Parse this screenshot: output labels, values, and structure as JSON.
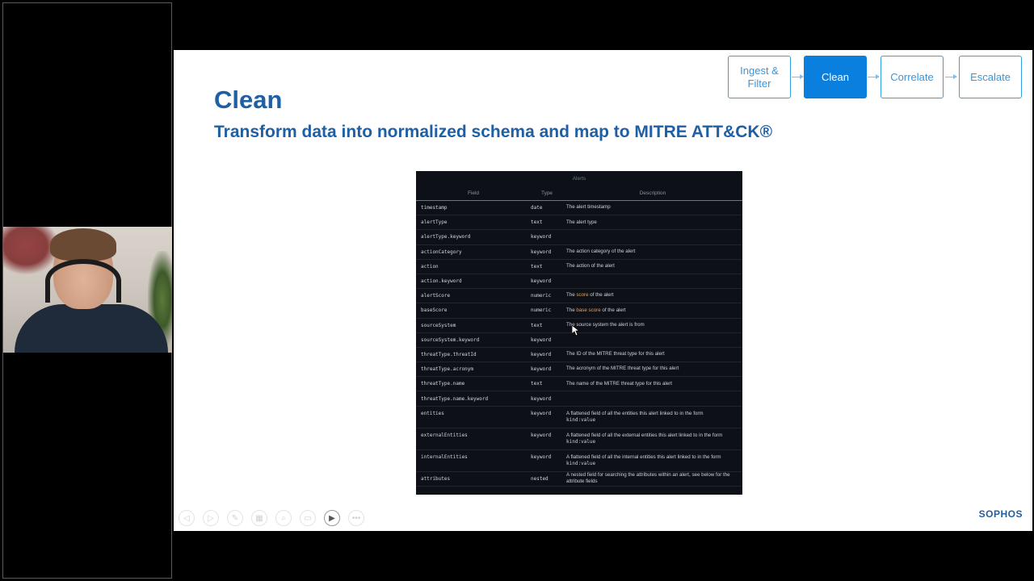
{
  "webcam": {
    "label": "presenter webcam"
  },
  "slide": {
    "title": "Clean",
    "subtitle": "Transform data into normalized schema and map to MITRE ATT&CK®",
    "flow": [
      {
        "label_line1": "Ingest &",
        "label_line2": "Filter",
        "active": false
      },
      {
        "label_line1": "Clean",
        "label_line2": "",
        "active": true
      },
      {
        "label_line1": "Correlate",
        "label_line2": "",
        "active": false
      },
      {
        "label_line1": "Escalate",
        "label_line2": "",
        "active": false
      }
    ],
    "brand": "SOPHOS"
  },
  "table": {
    "caption": "Alerts",
    "headers": {
      "field": "Field",
      "type": "Type",
      "description": "Description"
    },
    "rows": [
      {
        "field": "timestamp",
        "type": "date",
        "pre": "The alert timestamp",
        "hl": "",
        "post": "",
        "code": ""
      },
      {
        "field": "alertType",
        "type": "text",
        "pre": "The alert type",
        "hl": "",
        "post": "",
        "code": ""
      },
      {
        "field": "alertType.keyword",
        "type": "keyword",
        "pre": "",
        "hl": "",
        "post": "",
        "code": ""
      },
      {
        "field": "actionCategory",
        "type": "keyword",
        "pre": "The action category of the alert",
        "hl": "",
        "post": "",
        "code": ""
      },
      {
        "field": "action",
        "type": "text",
        "pre": "The action of the alert",
        "hl": "",
        "post": "",
        "code": ""
      },
      {
        "field": "action.keyword",
        "type": "keyword",
        "pre": "",
        "hl": "",
        "post": "",
        "code": ""
      },
      {
        "field": "alertScore",
        "type": "numeric",
        "pre": "The ",
        "hl": "score",
        "post": " of the alert",
        "code": ""
      },
      {
        "field": "baseScore",
        "type": "numeric",
        "pre": "The ",
        "hl": "base score",
        "post": " of the alert",
        "code": ""
      },
      {
        "field": "sourceSystem",
        "type": "text",
        "pre": "The source system the alert is from",
        "hl": "",
        "post": "",
        "code": ""
      },
      {
        "field": "sourceSystem.keyword",
        "type": "keyword",
        "pre": "",
        "hl": "",
        "post": "",
        "code": ""
      },
      {
        "field": "threatType.threatId",
        "type": "keyword",
        "pre": "The ID of the MITRE threat type for this alert",
        "hl": "",
        "post": "",
        "code": ""
      },
      {
        "field": "threatType.acronym",
        "type": "keyword",
        "pre": "The acronym of the MITRE threat type for this alert",
        "hl": "",
        "post": "",
        "code": ""
      },
      {
        "field": "threatType.name",
        "type": "text",
        "pre": "The name of the MITRE threat type for this alert",
        "hl": "",
        "post": "",
        "code": ""
      },
      {
        "field": "threatType.name.keyword",
        "type": "keyword",
        "pre": "",
        "hl": "",
        "post": "",
        "code": ""
      },
      {
        "field": "entities",
        "type": "keyword",
        "pre": "A flattened field of all the entities this alert linked to in the form",
        "hl": "",
        "post": "",
        "code": "kind:value"
      },
      {
        "field": "externalEntities",
        "type": "keyword",
        "pre": "A flattened field of all the external entities this alert linked to in the form",
        "hl": "",
        "post": "",
        "code": "kind:value"
      },
      {
        "field": "internalEntities",
        "type": "keyword",
        "pre": "A flattened field of all the internal entities this alert linked to in the form",
        "hl": "",
        "post": "",
        "code": "kind:value"
      },
      {
        "field": "attributes",
        "type": "nested",
        "pre": "A nested field for searching the attributes within an alert, see below for the attribute fields",
        "hl": "",
        "post": "",
        "code": ""
      }
    ]
  },
  "toolbar": {
    "buttons": [
      {
        "name": "previous-slide",
        "icon": "◁",
        "active": false
      },
      {
        "name": "next-slide",
        "icon": "▷",
        "active": false
      },
      {
        "name": "pen",
        "icon": "✎",
        "active": false
      },
      {
        "name": "all-slides",
        "icon": "▦",
        "active": false
      },
      {
        "name": "zoom",
        "icon": "⌕",
        "active": false
      },
      {
        "name": "subtitles",
        "icon": "▭",
        "active": false
      },
      {
        "name": "camera",
        "icon": "▶",
        "active": true
      },
      {
        "name": "more-options",
        "icon": "•••",
        "active": false
      }
    ]
  }
}
